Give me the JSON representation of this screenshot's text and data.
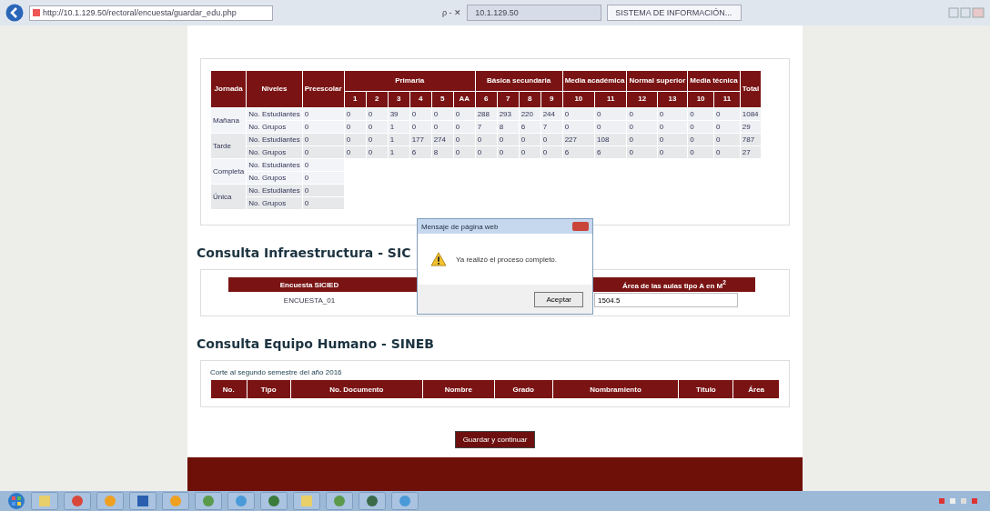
{
  "browser": {
    "address": "http://10.1.129.50/rectoral/encuesta/guardar_edu.php",
    "search": "ρ - ✕",
    "tabs": [
      {
        "label": "10.1.129.50",
        "selected": false
      },
      {
        "label": "SISTEMA DE INFORMACIÓN...",
        "selected": true
      }
    ]
  },
  "matricula": {
    "headers": {
      "jornada": "Jornada",
      "niveles": "Niveles",
      "preescolar": "Preescolar",
      "total": "Total"
    },
    "groups": [
      {
        "label": "Primaria",
        "grades": [
          "1",
          "2",
          "3",
          "4",
          "5",
          "AA"
        ]
      },
      {
        "label": "Básica secundaria",
        "grades": [
          "6",
          "7",
          "8",
          "9"
        ]
      },
      {
        "label": "Media académica",
        "grades": [
          "10",
          "11"
        ]
      },
      {
        "label": "Normal superior",
        "grades": [
          "12",
          "13"
        ]
      },
      {
        "label": "Media técnica",
        "grades": [
          "10",
          "11"
        ]
      }
    ],
    "rows": [
      {
        "jornada": "Mañana",
        "niveles": [
          {
            "label": "No. Estudiantes",
            "preescolar": "0",
            "values": [
              "0",
              "0",
              "39",
              "0",
              "0",
              "0",
              "288",
              "293",
              "220",
              "244",
              "0",
              "0",
              "0",
              "0",
              "0",
              "0"
            ],
            "total": "1084"
          },
          {
            "label": "No. Grupos",
            "preescolar": "0",
            "values": [
              "0",
              "0",
              "1",
              "0",
              "0",
              "0",
              "7",
              "8",
              "6",
              "7",
              "0",
              "0",
              "0",
              "0",
              "0",
              "0"
            ],
            "total": "29"
          }
        ]
      },
      {
        "jornada": "Tarde",
        "niveles": [
          {
            "label": "No. Estudiantes",
            "preescolar": "0",
            "values": [
              "0",
              "0",
              "1",
              "177",
              "274",
              "0",
              "0",
              "0",
              "0",
              "0",
              "227",
              "108",
              "0",
              "0",
              "0",
              "0"
            ],
            "total": "787"
          },
          {
            "label": "No. Grupos",
            "preescolar": "0",
            "values": [
              "0",
              "0",
              "1",
              "6",
              "8",
              "0",
              "0",
              "0",
              "0",
              "0",
              "6",
              "6",
              "0",
              "0",
              "0",
              "0"
            ],
            "total": "27"
          }
        ]
      },
      {
        "jornada": "Completa",
        "niveles": [
          {
            "label": "No. Estudiantes",
            "preescolar": "0"
          },
          {
            "label": "No. Grupos",
            "preescolar": "0"
          }
        ]
      },
      {
        "jornada": "Única",
        "niveles": [
          {
            "label": "No. Estudiantes",
            "preescolar": "0"
          },
          {
            "label": "No. Grupos",
            "preescolar": "0"
          }
        ]
      }
    ]
  },
  "infraestructura": {
    "title": "Consulta Infraestructura - SIC",
    "columns": [
      "Encuesta SICIED",
      "Área de las aulas tipo A en M$^{2}$"
    ],
    "row": {
      "encuesta": "ENCUESTA_01",
      "area": "1504.5"
    }
  },
  "equipo": {
    "title": "Consulta Equipo Humano - SINEB",
    "note": "Corte al segundo semestre del año 2016",
    "columns": [
      "No.",
      "Tipo",
      "No. Documento",
      "Nombre",
      "Grado",
      "Nombramiento",
      "Título",
      "Área"
    ]
  },
  "save_button": "Guardar y continuar",
  "dialog": {
    "title": "Mensaje de página web",
    "message": "Ya realizó el proceso completo.",
    "button": "Aceptar"
  },
  "taskbar": {
    "apps": [
      {
        "kind": "folder"
      },
      {
        "kind": "chrome"
      },
      {
        "kind": "sun"
      },
      {
        "kind": "word"
      },
      {
        "kind": "sun"
      },
      {
        "kind": "chart"
      },
      {
        "kind": "globe"
      },
      {
        "kind": "leaf"
      },
      {
        "kind": "folder"
      },
      {
        "kind": "chart"
      },
      {
        "kind": "photo"
      },
      {
        "kind": "globe"
      }
    ]
  }
}
